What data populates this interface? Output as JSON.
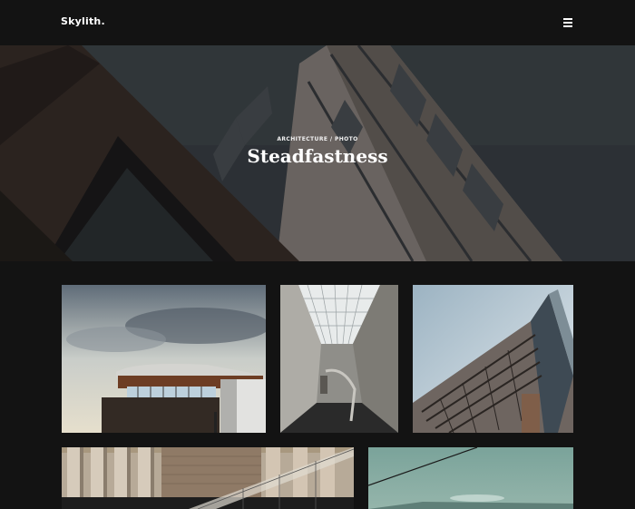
{
  "header": {
    "logo": "Skylith.",
    "menu_icon": "hamburger-menu-icon"
  },
  "hero": {
    "category_1": "ARCHITECTURE",
    "separator": "/",
    "category_2": "PHOTO",
    "title": "Steadfastness"
  },
  "gallery": {
    "items": [
      {
        "image": "building with curved wooden facade under cloudy sky"
      },
      {
        "image": "concrete interior corridor with skylight"
      },
      {
        "image": "skyscraper facade viewed from below against sky"
      },
      {
        "image": "building with pillars and staircase railing"
      },
      {
        "image": "teal sky with power line"
      }
    ]
  }
}
